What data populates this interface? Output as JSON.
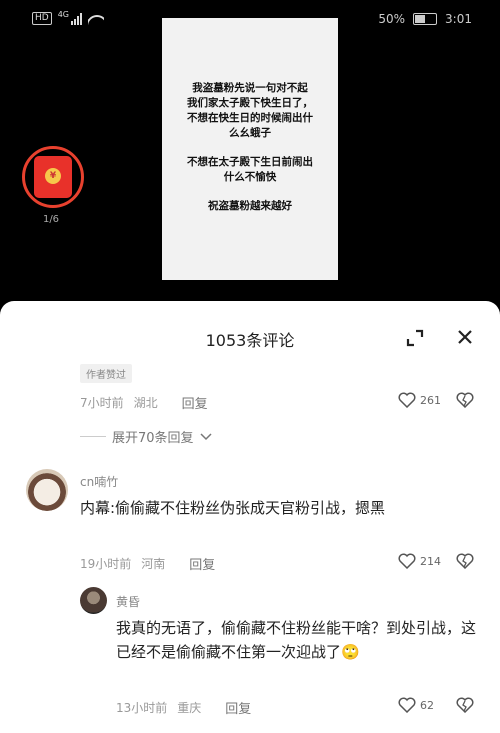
{
  "status_bar": {
    "network": "HD",
    "signal_type": "4G",
    "battery": "50%",
    "battery_level": 0.5,
    "time": "3:01"
  },
  "post_image": {
    "lines": [
      "我盗墓粉先说一句对不起",
      "我们家太子殿下快生日了，",
      "不想在快生日的时候闹出什",
      "么幺蛾子",
      "不想在太子殿下生日前闹出",
      "什么不愉快",
      "祝盗墓粉越来越好"
    ]
  },
  "red_envelope": {
    "count": "1/6"
  },
  "comments_panel": {
    "title": "1053条评论",
    "author_liked_tag": "作者赞过",
    "top_comment": {
      "time": "7小时前",
      "location": "湖北",
      "reply": "回复",
      "likes": "261"
    },
    "expand_replies": "展开70条回复",
    "comments": [
      {
        "username": "cn喃竹",
        "text": "内幕:偷偷藏不住粉丝伪张成天官粉引战，摁黑",
        "time": "19小时前",
        "location": "河南",
        "reply": "回复",
        "likes": "214"
      },
      {
        "username": "黄昏",
        "text": "我真的无语了，偷偷藏不住粉丝能干啥？到处引战，这已经不是偷偷藏不住第一次迎战了🙄",
        "time": "13小时前",
        "location": "重庆",
        "reply": "回复",
        "likes": "62"
      }
    ]
  },
  "colors": {
    "accent": "#e8412e",
    "panel_bg": "#ffffff",
    "screen_bg": "#000000"
  }
}
